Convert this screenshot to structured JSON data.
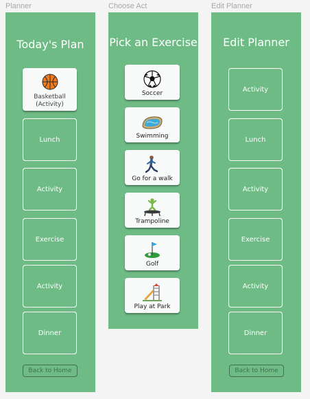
{
  "frames": {
    "planner": "Planner",
    "choose": "Choose Act",
    "edit": "Edit Planner"
  },
  "planner": {
    "title": "Today's Plan",
    "filled_item": {
      "line1": "Basketball",
      "line2": "(Activity)",
      "icon": "basketball-icon"
    },
    "slots": [
      "Lunch",
      "Activity",
      "Exercise",
      "Activity",
      "Dinner"
    ],
    "back_label": "Back to Home"
  },
  "choose": {
    "title": "Pick an Exercise",
    "cards": [
      {
        "label": "Soccer",
        "icon": "soccer-ball-icon"
      },
      {
        "label": "Swimming",
        "icon": "swimming-pool-icon"
      },
      {
        "label": "Go for a walk",
        "icon": "walking-person-icon"
      },
      {
        "label": "Trampoline",
        "icon": "trampoline-icon"
      },
      {
        "label": "Golf",
        "icon": "golf-flag-icon"
      },
      {
        "label": "Play at Park",
        "icon": "playground-slide-icon"
      }
    ]
  },
  "edit": {
    "title": "Edit Planner",
    "slots": [
      "Activity",
      "Lunch",
      "Activity",
      "Exercise",
      "Activity",
      "Dinner"
    ],
    "back_label": "Back to Home"
  },
  "colors": {
    "panel": "#6fbb86",
    "card": "#f7faf8",
    "button_border": "#3f7150",
    "frame_label": "#a8a8a8"
  }
}
